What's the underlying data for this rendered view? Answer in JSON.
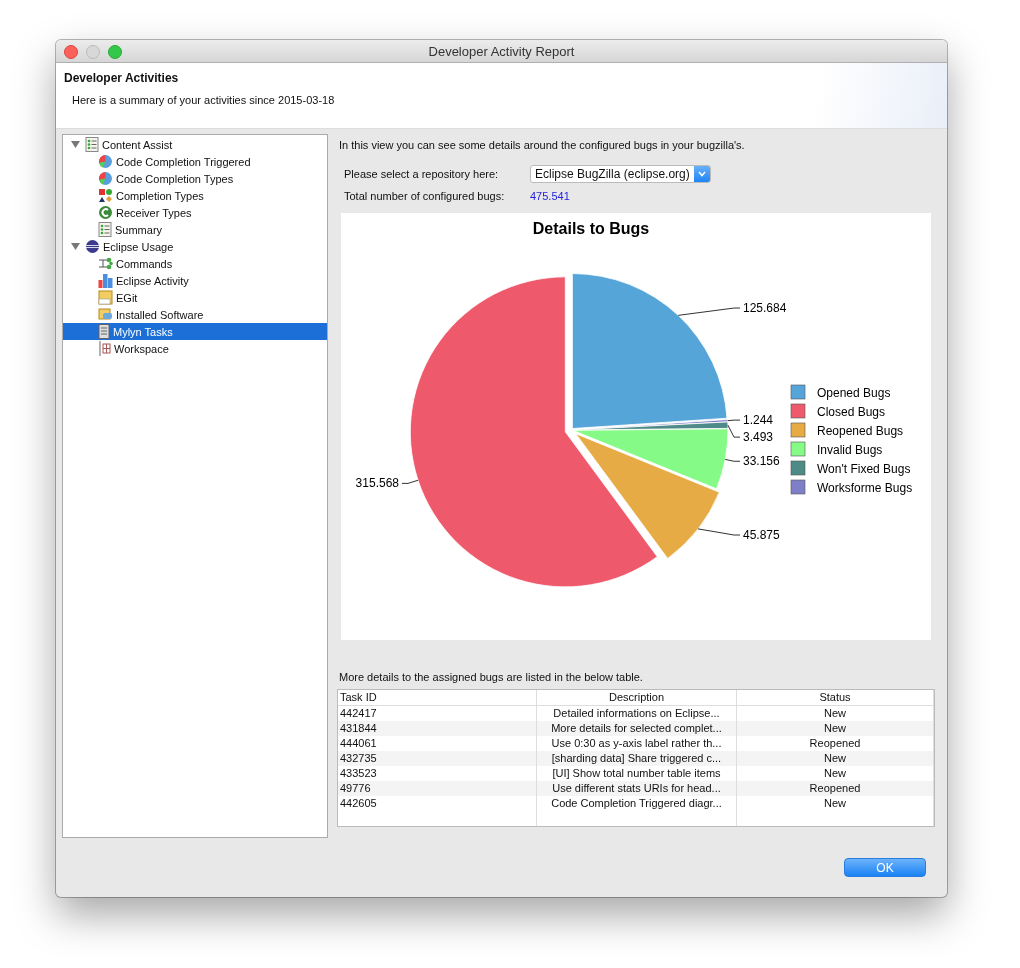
{
  "window": {
    "title": "Developer Activity Report"
  },
  "header": {
    "title": "Developer Activities",
    "subtitle": "Here is a summary of your activities since 2015-03-18"
  },
  "tree": [
    {
      "label": "Content Assist",
      "expanded": true,
      "selected": false,
      "children": [
        {
          "label": "Code Completion Triggered",
          "selected": false
        },
        {
          "label": "Code Completion Types",
          "selected": false
        },
        {
          "label": "Completion Types",
          "selected": false
        },
        {
          "label": "Receiver Types",
          "selected": false
        },
        {
          "label": "Summary",
          "selected": false
        }
      ]
    },
    {
      "label": "Eclipse Usage",
      "expanded": true,
      "selected": false,
      "children": [
        {
          "label": "Commands",
          "selected": false
        },
        {
          "label": "Eclipse Activity",
          "selected": false
        },
        {
          "label": "EGit",
          "selected": false
        },
        {
          "label": "Installed Software",
          "selected": false
        },
        {
          "label": "Mylyn Tasks",
          "selected": true
        },
        {
          "label": "Workspace",
          "selected": false
        }
      ]
    }
  ],
  "intro": "In this view you can see some details around the configured bugs in your bugzilla's.",
  "repository": {
    "label": "Please select a repository here:",
    "value": "Eclipse BugZilla (eclipse.org)"
  },
  "total": {
    "label": "Total number of configured bugs:",
    "value": "475.541"
  },
  "chart_data": {
    "type": "pie",
    "title": "Details to Bugs",
    "categories": [
      "Opened Bugs",
      "Closed Bugs",
      "Reopened Bugs",
      "Invalid Bugs",
      "Won't Fixed Bugs",
      "Worksforme Bugs"
    ],
    "values": [
      125.684,
      315.568,
      45.875,
      33.156,
      3.493,
      1.244
    ],
    "legend": true,
    "colors": [
      "#56a5d8",
      "#ee5a6c",
      "#e6ab45",
      "#86fa86",
      "#4d8a88",
      "#7f7fc8"
    ],
    "data_labels": true,
    "value_labels": [
      "125.684",
      "315.568",
      "45.875",
      "33.156",
      "3.493",
      "1.244"
    ]
  },
  "table_caption": "More details to the assigned bugs are listed in the below table.",
  "table": {
    "columns": [
      "Task ID",
      "Description",
      "Status"
    ],
    "rows": [
      [
        "442417",
        "Detailed informations on Eclipse...",
        "New"
      ],
      [
        "431844",
        "More details for selected complet...",
        "New"
      ],
      [
        "444061",
        "Use 0:30 as y-axis label rather th...",
        "Reopened"
      ],
      [
        "432735",
        "[sharding data] Share triggered c...",
        "New"
      ],
      [
        "433523",
        "[UI] Show total number table items",
        "New"
      ],
      [
        "49776",
        "Use different stats URIs for head...",
        "Reopened"
      ],
      [
        "442605",
        "Code Completion Triggered diagr...",
        "New"
      ]
    ]
  },
  "buttons": [
    "OK"
  ]
}
